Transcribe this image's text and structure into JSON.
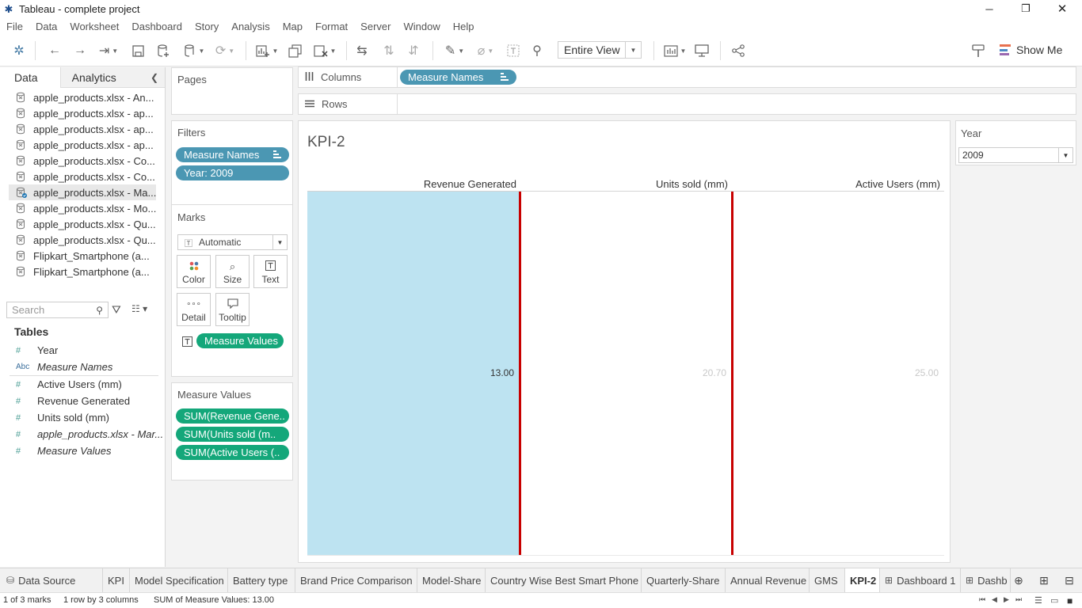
{
  "window": {
    "title": "Tableau - complete project"
  },
  "menu": [
    "File",
    "Data",
    "Worksheet",
    "Dashboard",
    "Story",
    "Analysis",
    "Map",
    "Format",
    "Server",
    "Window",
    "Help"
  ],
  "toolbar": {
    "fit": "Entire View",
    "show_me": "Show Me"
  },
  "datapane": {
    "tab_data": "Data",
    "tab_analytics": "Analytics",
    "sources": [
      "apple_products.xlsx - An...",
      "apple_products.xlsx - ap...",
      "apple_products.xlsx - ap...",
      "apple_products.xlsx - ap...",
      "apple_products.xlsx - Co...",
      "apple_products.xlsx - Co...",
      "apple_products.xlsx - Ma...",
      "apple_products.xlsx - Mo...",
      "apple_products.xlsx - Qu...",
      "apple_products.xlsx - Qu...",
      "Flipkart_Smartphone (a...",
      "Flipkart_Smartphone (a..."
    ],
    "active_source_index": 6,
    "search_placeholder": "Search",
    "tables_heading": "Tables",
    "fields": [
      {
        "type": "#",
        "name": "Year"
      },
      {
        "type": "Abc",
        "name": "Measure Names"
      },
      {
        "type": "#",
        "name": "Active Users (mm)"
      },
      {
        "type": "#",
        "name": "Revenue Generated"
      },
      {
        "type": "#",
        "name": "Units sold (mm)"
      },
      {
        "type": "#",
        "name": "apple_products.xlsx - Mar..."
      },
      {
        "type": "#",
        "name": "Measure Values"
      }
    ]
  },
  "cards": {
    "pages": "Pages",
    "filters": "Filters",
    "filter_pills": [
      "Measure Names",
      "Year: 2009"
    ],
    "marks": "Marks",
    "mark_type": "Automatic",
    "mark_buttons": {
      "color": "Color",
      "size": "Size",
      "text": "Text",
      "detail": "Detail",
      "tooltip": "Tooltip"
    },
    "marks_pill": "Measure Values",
    "measure_values": "Measure Values",
    "measure_pills": [
      "SUM(Revenue Gene..",
      "SUM(Units sold (m..",
      "SUM(Active Users (.."
    ]
  },
  "shelves": {
    "columns_label": "Columns",
    "columns_pill": "Measure Names",
    "rows_label": "Rows"
  },
  "view": {
    "sheet_title": "KPI-2",
    "headers": [
      "Revenue Generated",
      "Units sold (mm)",
      "Active Users (mm)"
    ],
    "labels": [
      "13.00",
      "20.70",
      "25.00"
    ],
    "fill_color": "#bde3f1",
    "border_color": "#c80000"
  },
  "chart_data": {
    "type": "table",
    "title": "KPI-2",
    "categories": [
      "Revenue Generated",
      "Units sold (mm)",
      "Active Users (mm)"
    ],
    "values": [
      13.0,
      20.7,
      25.0
    ],
    "highlighted": "Revenue Generated"
  },
  "year_filter": {
    "title": "Year",
    "value": "2009"
  },
  "sheet_tabs": [
    {
      "label": "Data Source",
      "icon": "database-icon"
    },
    {
      "label": "KPI"
    },
    {
      "label": "Model Specification"
    },
    {
      "label": "Battery type"
    },
    {
      "label": "Brand Price Comparison"
    },
    {
      "label": "Model-Share"
    },
    {
      "label": "Country Wise Best Smart Phone"
    },
    {
      "label": "Quarterly-Share"
    },
    {
      "label": "Annual Revenue"
    },
    {
      "label": "GMS"
    },
    {
      "label": "KPI-2",
      "active": true
    },
    {
      "label": "Dashboard 1",
      "icon": "dashboard-icon"
    },
    {
      "label": "Dashb",
      "icon": "dashboard-icon"
    }
  ],
  "status": {
    "marks": "1 of 3 marks",
    "dims": "1 row by 3 columns",
    "sum": "SUM of Measure Values: 13.00"
  }
}
